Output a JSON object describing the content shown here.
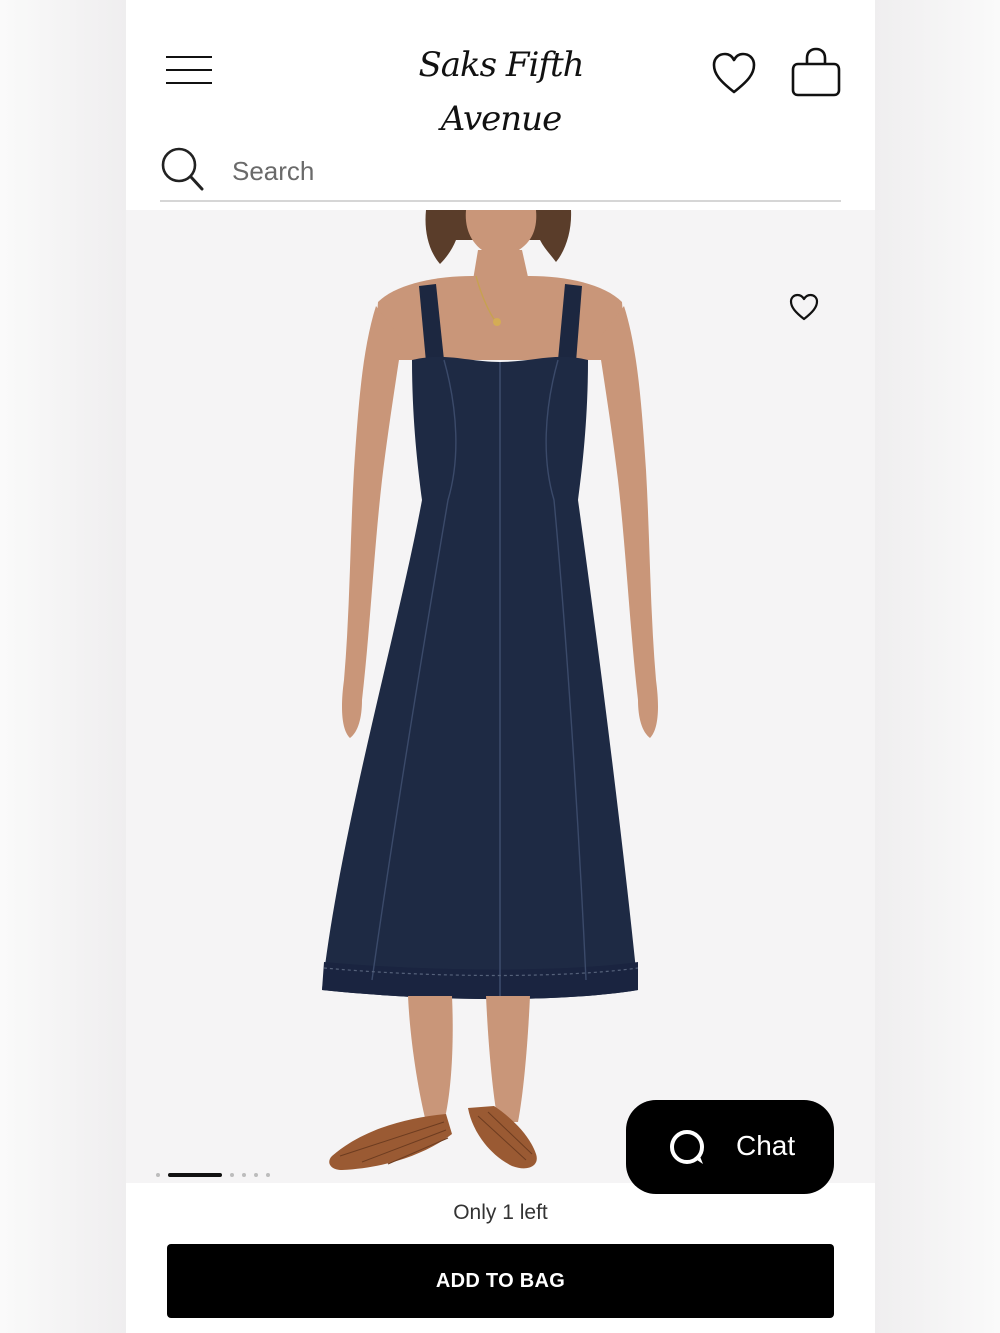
{
  "header": {
    "logo_text": "Saks Fifth Avenue",
    "icons": {
      "menu": "hamburger-menu-icon",
      "wishlist": "heart-icon",
      "bag": "shopping-bag-icon"
    }
  },
  "search": {
    "placeholder": "Search",
    "value": ""
  },
  "product": {
    "image_description_icon": "product-photo",
    "favorite_icon": "heart-outline-icon",
    "carousel": {
      "total": 7,
      "active_index": 1
    }
  },
  "chat": {
    "label": "Chat"
  },
  "purchase": {
    "stock_note": "Only 1 left",
    "add_to_bag_label": "ADD TO BAG"
  },
  "colors": {
    "dress": "#1e2a44",
    "button_bg": "#000000",
    "image_bg": "#f5f4f5"
  }
}
